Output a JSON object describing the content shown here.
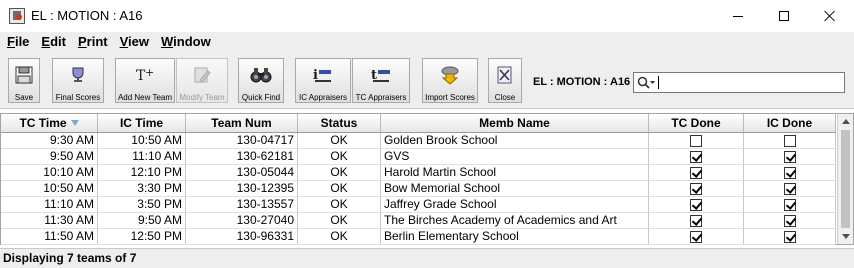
{
  "window": {
    "title": "EL : MOTION : A16"
  },
  "menu": [
    "File",
    "Edit",
    "Print",
    "View",
    "Window"
  ],
  "toolbar": {
    "buttons": [
      {
        "label": "Save",
        "icon": "save-icon",
        "enabled": true
      },
      {
        "label": "Final Scores",
        "icon": "trophy-icon",
        "enabled": true
      },
      {
        "label": "Add New Team",
        "icon": "add-team-icon",
        "enabled": true
      },
      {
        "label": "Modify Team",
        "icon": "edit-icon",
        "enabled": false
      },
      {
        "label": "Quick Find",
        "icon": "binoculars-icon",
        "enabled": true
      },
      {
        "label": "IC Appraisers",
        "icon": "ic-appraisers-icon",
        "enabled": true
      },
      {
        "label": "TC Appraisers",
        "icon": "tc-appraisers-icon",
        "enabled": true
      },
      {
        "label": "Import Scores",
        "icon": "import-icon",
        "enabled": true
      },
      {
        "label": "Close",
        "icon": "close-doc-icon",
        "enabled": true
      }
    ],
    "context_label": "EL : MOTION : A16",
    "search": {
      "value": "",
      "placeholder": ""
    }
  },
  "table": {
    "columns": [
      "TC Time",
      "IC Time",
      "Team Num",
      "Status",
      "Memb Name",
      "TC Done",
      "IC Done"
    ],
    "sorted_column": "TC Time",
    "rows": [
      {
        "tc_time": "9:30 AM",
        "ic_time": "10:50 AM",
        "team_num": "130-04717",
        "status": "OK",
        "memb_name": "Golden Brook School",
        "tc_done": false,
        "ic_done": false
      },
      {
        "tc_time": "9:50 AM",
        "ic_time": "11:10 AM",
        "team_num": "130-62181",
        "status": "OK",
        "memb_name": "GVS",
        "tc_done": true,
        "ic_done": true
      },
      {
        "tc_time": "10:10 AM",
        "ic_time": "12:10 PM",
        "team_num": "130-05044",
        "status": "OK",
        "memb_name": "Harold Martin School",
        "tc_done": true,
        "ic_done": true
      },
      {
        "tc_time": "10:50 AM",
        "ic_time": "3:30 PM",
        "team_num": "130-12395",
        "status": "OK",
        "memb_name": "Bow Memorial School",
        "tc_done": true,
        "ic_done": true
      },
      {
        "tc_time": "11:10 AM",
        "ic_time": "3:50 PM",
        "team_num": "130-13557",
        "status": "OK",
        "memb_name": "Jaffrey Grade School",
        "tc_done": true,
        "ic_done": true
      },
      {
        "tc_time": "11:30 AM",
        "ic_time": "9:50 AM",
        "team_num": "130-27040",
        "status": "OK",
        "memb_name": "The Birches Academy of Academics and Art",
        "tc_done": true,
        "ic_done": true
      },
      {
        "tc_time": "11:50 AM",
        "ic_time": "12:50 PM",
        "team_num": "130-96331",
        "status": "OK",
        "memb_name": "Berlin Elementary School",
        "tc_done": true,
        "ic_done": true
      }
    ]
  },
  "status": {
    "text": "Displaying 7 teams of 7"
  }
}
